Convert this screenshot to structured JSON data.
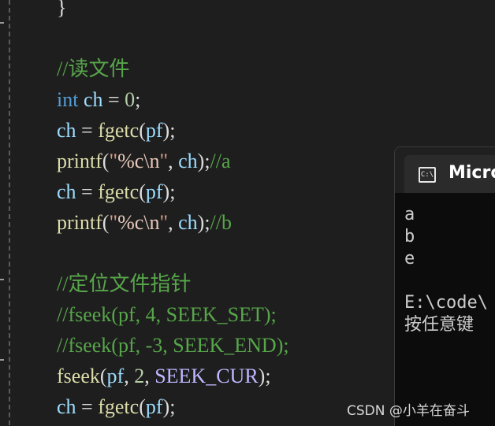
{
  "editor": {
    "lines": [
      {
        "tokens": [
          {
            "t": "}",
            "c": "pun"
          }
        ]
      },
      {
        "tokens": []
      },
      {
        "tokens": [
          {
            "t": "//读文件",
            "c": "cm"
          }
        ]
      },
      {
        "tokens": [
          {
            "t": "int",
            "c": "kw"
          },
          {
            "t": " ",
            "c": "pun"
          },
          {
            "t": "ch",
            "c": "var"
          },
          {
            "t": " = ",
            "c": "pun"
          },
          {
            "t": "0",
            "c": "num"
          },
          {
            "t": ";",
            "c": "pun"
          }
        ]
      },
      {
        "tokens": [
          {
            "t": "ch",
            "c": "var"
          },
          {
            "t": " = ",
            "c": "pun"
          },
          {
            "t": "fgetc",
            "c": "fn"
          },
          {
            "t": "(",
            "c": "pun"
          },
          {
            "t": "pf",
            "c": "var"
          },
          {
            "t": ");",
            "c": "pun"
          }
        ]
      },
      {
        "tokens": [
          {
            "t": "printf",
            "c": "fn"
          },
          {
            "t": "(",
            "c": "pun"
          },
          {
            "t": "\"",
            "c": "str"
          },
          {
            "t": "%c\\n",
            "c": "esc"
          },
          {
            "t": "\"",
            "c": "str"
          },
          {
            "t": ", ",
            "c": "pun"
          },
          {
            "t": "ch",
            "c": "var"
          },
          {
            "t": ");",
            "c": "pun"
          },
          {
            "t": "//a",
            "c": "cm"
          }
        ]
      },
      {
        "tokens": [
          {
            "t": "ch",
            "c": "var"
          },
          {
            "t": " = ",
            "c": "pun"
          },
          {
            "t": "fgetc",
            "c": "fn"
          },
          {
            "t": "(",
            "c": "pun"
          },
          {
            "t": "pf",
            "c": "var"
          },
          {
            "t": ");",
            "c": "pun"
          }
        ]
      },
      {
        "tokens": [
          {
            "t": "printf",
            "c": "fn"
          },
          {
            "t": "(",
            "c": "pun"
          },
          {
            "t": "\"",
            "c": "str"
          },
          {
            "t": "%c\\n",
            "c": "esc"
          },
          {
            "t": "\"",
            "c": "str"
          },
          {
            "t": ", ",
            "c": "pun"
          },
          {
            "t": "ch",
            "c": "var"
          },
          {
            "t": ");",
            "c": "pun"
          },
          {
            "t": "//b",
            "c": "cm"
          }
        ]
      },
      {
        "tokens": []
      },
      {
        "tokens": [
          {
            "t": "//定位文件指针",
            "c": "cm"
          }
        ]
      },
      {
        "tokens": [
          {
            "t": "//fseek(pf, 4, SEEK_SET);",
            "c": "cm"
          }
        ]
      },
      {
        "tokens": [
          {
            "t": "//fseek(pf, -3, SEEK_END);",
            "c": "cm"
          }
        ]
      },
      {
        "tokens": [
          {
            "t": "fseek",
            "c": "fn"
          },
          {
            "t": "(",
            "c": "pun"
          },
          {
            "t": "pf",
            "c": "var"
          },
          {
            "t": ", ",
            "c": "pun"
          },
          {
            "t": "2",
            "c": "num"
          },
          {
            "t": ", ",
            "c": "pun"
          },
          {
            "t": "SEEK_CUR",
            "c": "mac"
          },
          {
            "t": ");",
            "c": "pun"
          }
        ]
      },
      {
        "tokens": [
          {
            "t": "ch",
            "c": "var"
          },
          {
            "t": " = ",
            "c": "pun"
          },
          {
            "t": "fgetc",
            "c": "fn"
          },
          {
            "t": "(",
            "c": "pun"
          },
          {
            "t": "pf",
            "c": "var"
          },
          {
            "t": ");",
            "c": "pun"
          }
        ]
      }
    ]
  },
  "console": {
    "title": "Micro",
    "icon": "terminal-icon",
    "icon_glyph": "C:\\",
    "output": [
      "a",
      "b",
      "e",
      "",
      "E:\\code\\",
      "按任意键"
    ]
  },
  "watermark": "CSDN @小羊在奋斗"
}
